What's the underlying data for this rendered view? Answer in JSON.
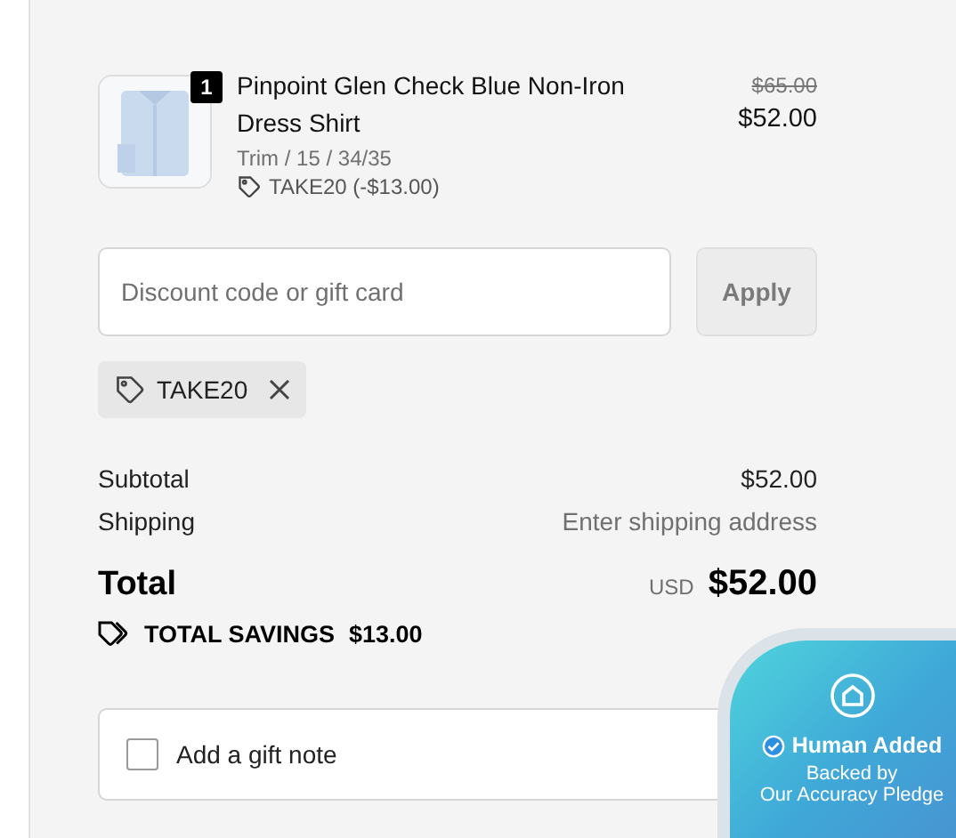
{
  "line_item": {
    "quantity": "1",
    "name": "Pinpoint Glen Check Blue Non-Iron Dress Shirt",
    "variant": "Trim / 15 / 34/35",
    "discount": "TAKE20 (-$13.00)",
    "original_price": "$65.00",
    "price": "$52.00"
  },
  "discount_field": {
    "placeholder": "Discount code or gift card",
    "button": "Apply"
  },
  "applied_code": {
    "code": "TAKE20"
  },
  "summary": [
    {
      "label": "Subtotal",
      "value": "$52.00",
      "kind": "amount"
    },
    {
      "label": "Shipping",
      "value": "Enter shipping address",
      "kind": "hint"
    }
  ],
  "total": {
    "label": "Total",
    "currency": "USD",
    "value": "$52.00"
  },
  "savings": {
    "label": "TOTAL SAVINGS",
    "value": "$13.00"
  },
  "gift_note": {
    "label": "Add a gift note",
    "checked": false
  },
  "trust_badge": {
    "title": "Human Added",
    "subtitle": "Backed by\nOur Accuracy Pledge"
  }
}
